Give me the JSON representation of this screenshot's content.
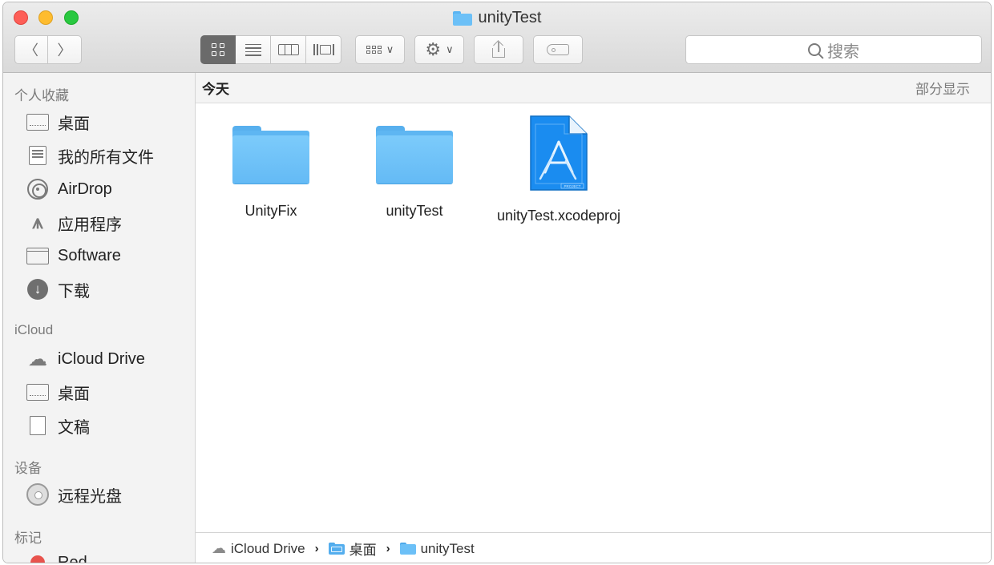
{
  "window": {
    "title": "unityTest"
  },
  "toolbar": {
    "back_icon": "chevron-left-icon",
    "forward_icon": "chevron-right-icon",
    "views": [
      "icon",
      "list",
      "columns",
      "cover-flow"
    ],
    "active_view": "icon",
    "search_placeholder": "搜索"
  },
  "sidebar": {
    "favorites_title": "个人收藏",
    "favorites": [
      {
        "label": "桌面",
        "icon": "desktop-icon"
      },
      {
        "label": "我的所有文件",
        "icon": "all-files-icon"
      },
      {
        "label": "AirDrop",
        "icon": "airdrop-icon"
      },
      {
        "label": "应用程序",
        "icon": "applications-icon"
      },
      {
        "label": "Software",
        "icon": "folder-icon"
      },
      {
        "label": "下载",
        "icon": "download-icon"
      }
    ],
    "icloud_title": "iCloud",
    "icloud": [
      {
        "label": "iCloud Drive",
        "icon": "cloud-icon"
      },
      {
        "label": "桌面",
        "icon": "desktop-icon"
      },
      {
        "label": "文稿",
        "icon": "documents-icon"
      }
    ],
    "devices_title": "设备",
    "devices": [
      {
        "label": "远程光盘",
        "icon": "disc-icon"
      }
    ],
    "tags_title": "标记",
    "tags": [
      {
        "label": "Red",
        "color": "#e8534d"
      }
    ]
  },
  "main": {
    "group_title": "今天",
    "group_more": "部分显示",
    "files": [
      {
        "name": "UnityFix",
        "kind": "folder"
      },
      {
        "name": "unityTest",
        "kind": "folder"
      },
      {
        "name": "unityTest.xcodeproj",
        "kind": "xcodeproj",
        "badge": "PROJECT"
      }
    ]
  },
  "pathbar": {
    "segments": [
      "iCloud Drive",
      "桌面",
      "unityTest"
    ]
  },
  "colors": {
    "accent": "#1a8cf0",
    "folder": "#6cc0f7",
    "close": "#fd5e57",
    "minimize": "#febc2e",
    "maximize": "#29c840"
  }
}
